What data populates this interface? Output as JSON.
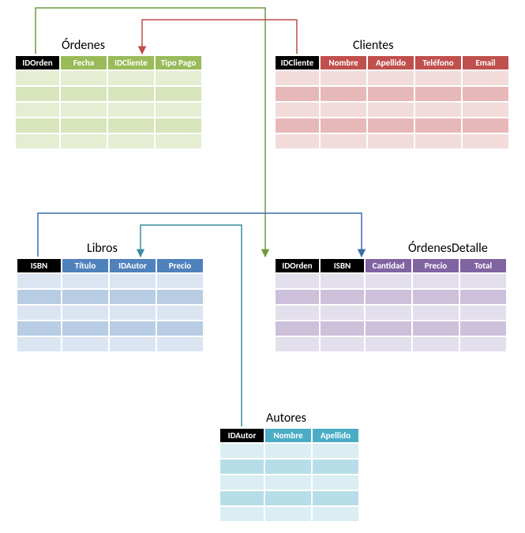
{
  "tables": {
    "ordenes": {
      "title": "Órdenes",
      "color": "#9ABB59",
      "columns": [
        {
          "name": "IDOrden",
          "pk": true
        },
        {
          "name": "Fecha",
          "pk": false
        },
        {
          "name": "IDCliente",
          "pk": false
        },
        {
          "name": "Tipo Pago",
          "pk": false
        }
      ],
      "rowCount": 5
    },
    "clientes": {
      "title": "Clientes",
      "color": "#C0504D",
      "columns": [
        {
          "name": "IDCliente",
          "pk": true
        },
        {
          "name": "Nombre",
          "pk": false
        },
        {
          "name": "Apellido",
          "pk": false
        },
        {
          "name": "Teléfono",
          "pk": false
        },
        {
          "name": "Email",
          "pk": false
        }
      ],
      "rowCount": 5
    },
    "libros": {
      "title": "Libros",
      "color": "#4F81BD",
      "columns": [
        {
          "name": "ISBN",
          "pk": true
        },
        {
          "name": "Título",
          "pk": false
        },
        {
          "name": "IDAutor",
          "pk": false
        },
        {
          "name": "Precio",
          "pk": false
        }
      ],
      "rowCount": 5
    },
    "ordenesDetalle": {
      "title": "ÓrdenesDetalle",
      "color": "#8064A2",
      "columns": [
        {
          "name": "IDOrden",
          "pk": true
        },
        {
          "name": "ISBN",
          "pk": true
        },
        {
          "name": "Cantidad",
          "pk": false
        },
        {
          "name": "Precio",
          "pk": false
        },
        {
          "name": "Total",
          "pk": false
        }
      ],
      "rowCount": 5
    },
    "autores": {
      "title": "Autores",
      "color": "#4BACC6",
      "columns": [
        {
          "name": "IDAutor",
          "pk": true
        },
        {
          "name": "Nombre",
          "pk": false
        },
        {
          "name": "Apellido",
          "pk": false
        }
      ],
      "rowCount": 5
    }
  },
  "relationships": [
    {
      "from": "ordenes.IDOrden",
      "to": "ordenesDetalle.IDOrden",
      "color": "#6F9A3E"
    },
    {
      "from": "clientes.IDCliente",
      "to": "ordenes.IDCliente",
      "color": "#BE4B48"
    },
    {
      "from": "libros.ISBN",
      "to": "ordenesDetalle.ISBN",
      "color": "#3A6DA8"
    },
    {
      "from": "autores.IDAutor",
      "to": "libros.IDAutor",
      "color": "#3C8DA3"
    }
  ]
}
